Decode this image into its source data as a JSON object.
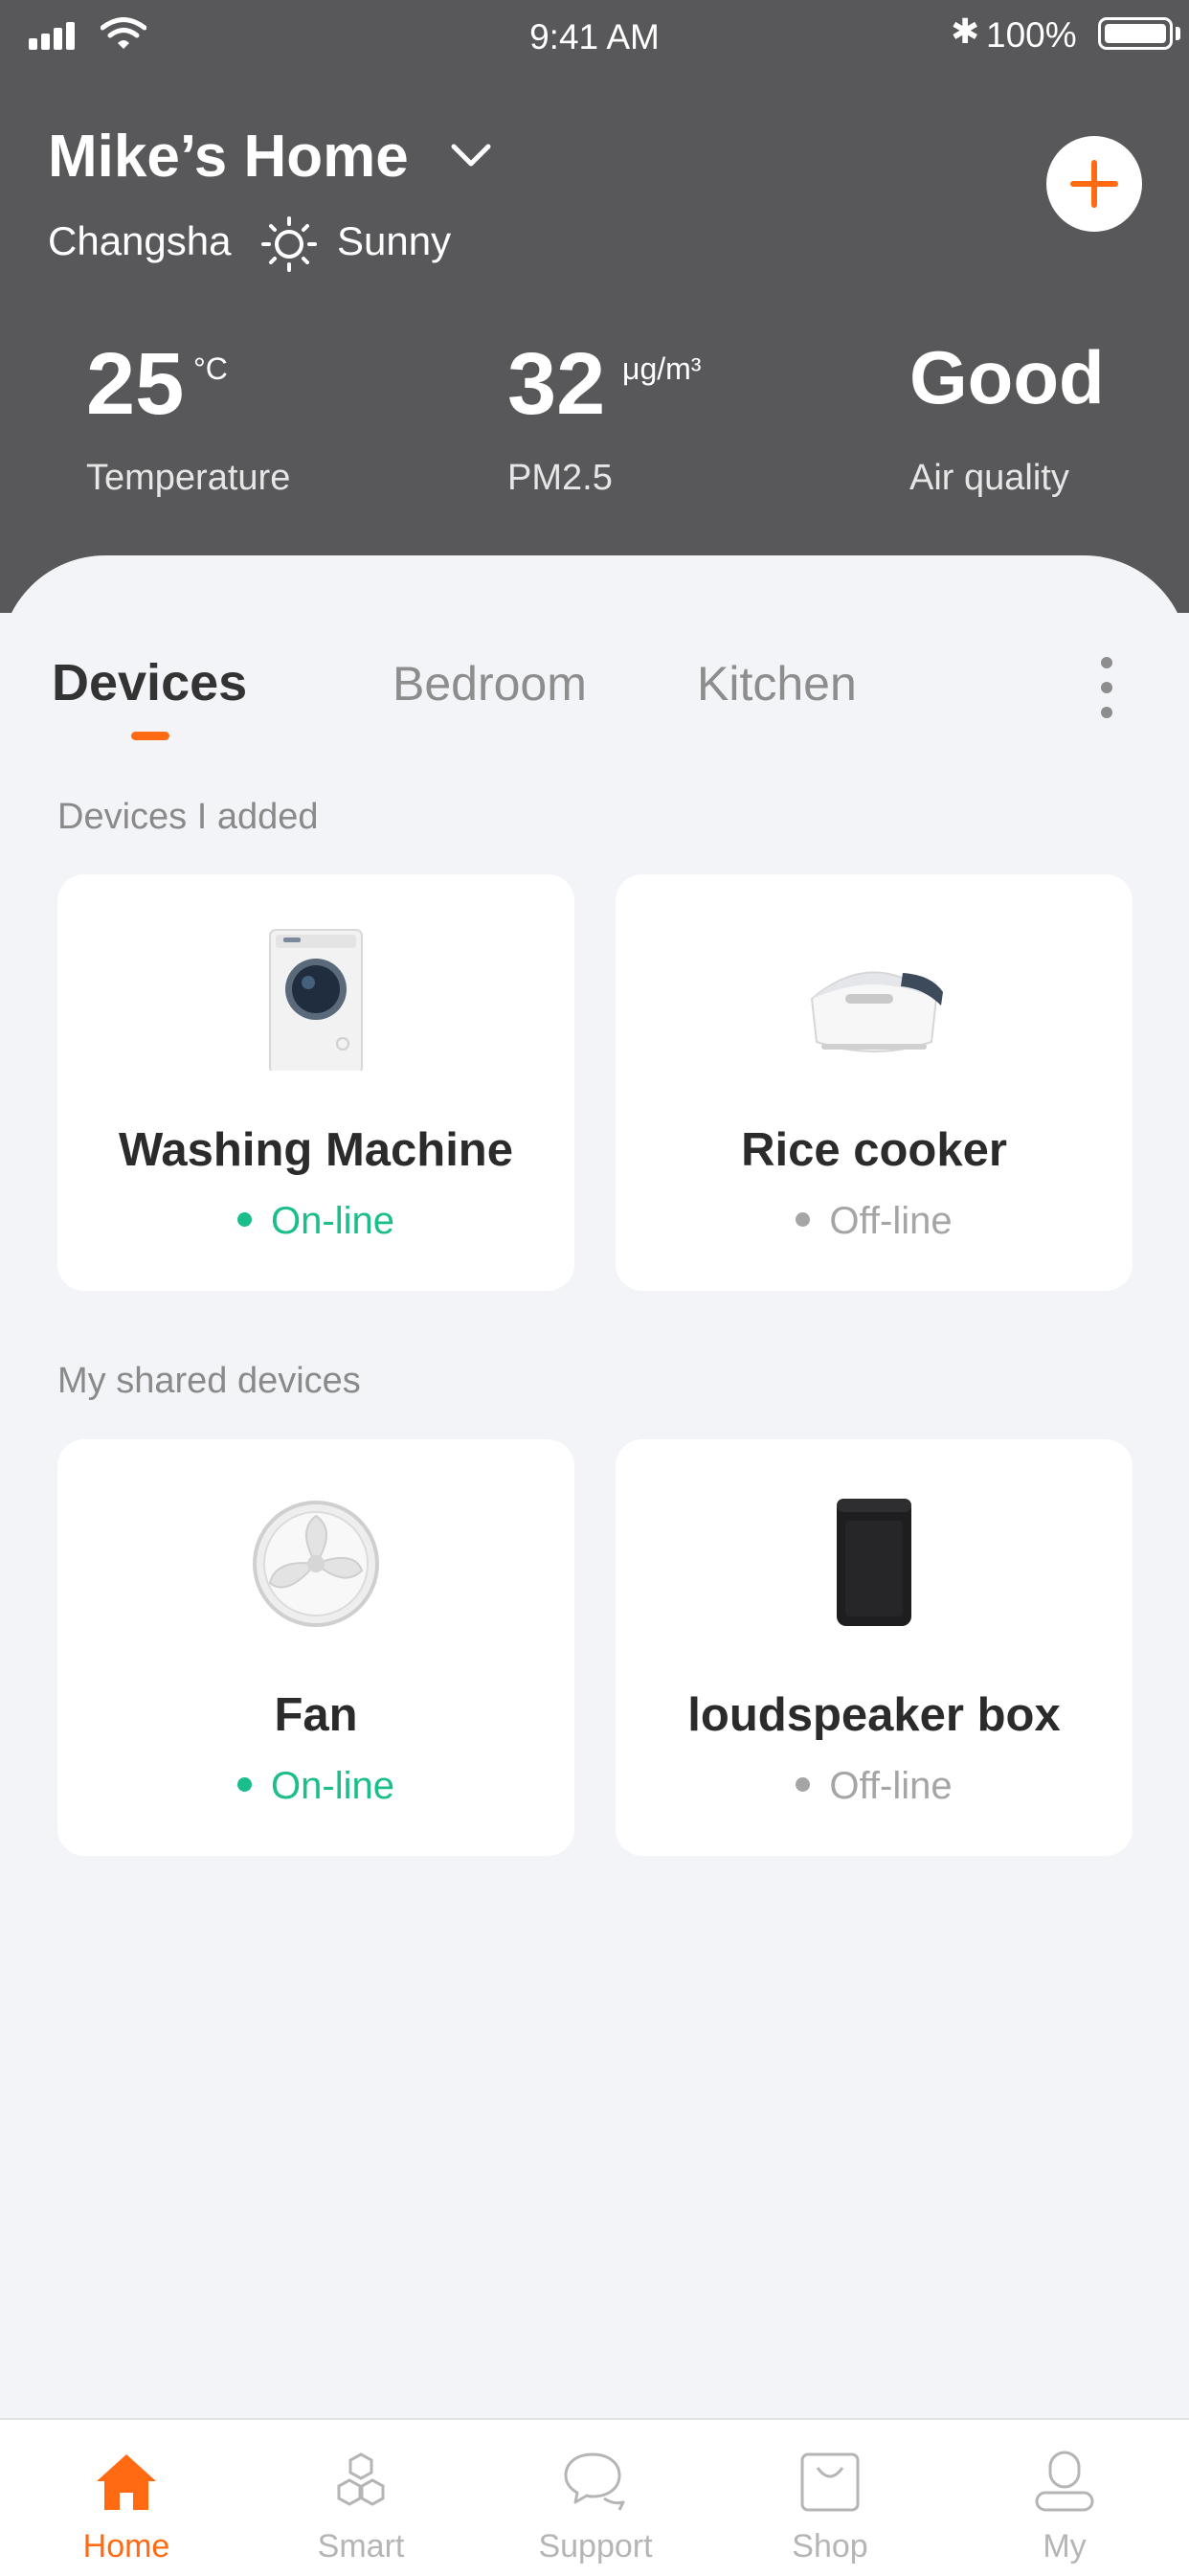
{
  "status_bar": {
    "time": "9:41 AM",
    "battery": "100%"
  },
  "header": {
    "home_name": "Mike’s Home",
    "city": "Changsha",
    "weather": "Sunny",
    "stats": [
      {
        "value": "25",
        "unit": "°C",
        "label": "Temperature"
      },
      {
        "value": "32",
        "unit": "μg/m³",
        "label": "PM2.5"
      },
      {
        "value": "Good",
        "unit": "",
        "label": "Air quality"
      }
    ]
  },
  "tabs": [
    {
      "label": "Devices",
      "active": true
    },
    {
      "label": "Bedroom",
      "active": false
    },
    {
      "label": "Kitchen",
      "active": false
    }
  ],
  "sections": {
    "added": {
      "title": "Devices I added",
      "devices": [
        {
          "name": "Washing Machine",
          "status": "On-line",
          "icon": "washing-machine"
        },
        {
          "name": "Rice cooker",
          "status": "Off-line",
          "icon": "rice-cooker"
        }
      ]
    },
    "shared": {
      "title": "My shared devices",
      "devices": [
        {
          "name": "Fan",
          "status": "On-line",
          "icon": "fan"
        },
        {
          "name": "loudspeaker box",
          "status": "Off-line",
          "icon": "speaker"
        }
      ]
    }
  },
  "tabbar": [
    {
      "label": "Home",
      "icon": "home-icon",
      "active": true
    },
    {
      "label": "Smart",
      "icon": "hexagons-icon",
      "active": false
    },
    {
      "label": "Support",
      "icon": "chat-bubbles-icon",
      "active": false
    },
    {
      "label": "Shop",
      "icon": "shopping-bag-icon",
      "active": false
    },
    {
      "label": "My",
      "icon": "person-icon",
      "active": false
    }
  ],
  "colors": {
    "accent": "#ff6a13",
    "online": "#1bbd8a",
    "offline": "#a5a5a5",
    "header_bg": "#58585a"
  }
}
